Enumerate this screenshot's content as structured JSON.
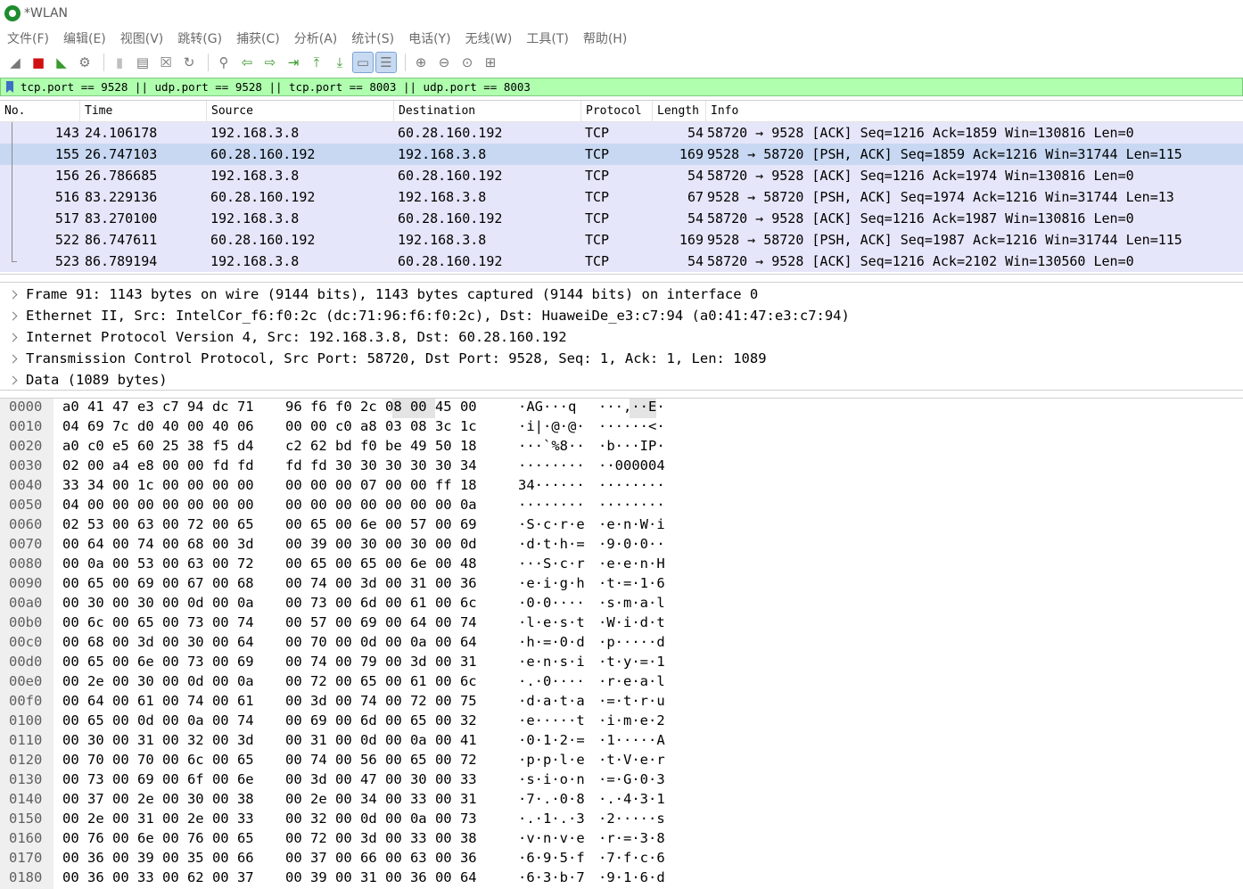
{
  "window": {
    "title": "*WLAN"
  },
  "menu": [
    "文件(F)",
    "编辑(E)",
    "视图(V)",
    "跳转(G)",
    "捕获(C)",
    "分析(A)",
    "统计(S)",
    "电话(Y)",
    "无线(W)",
    "工具(T)",
    "帮助(H)"
  ],
  "filter": {
    "value": "tcp.port == 9528 || udp.port == 9528 || tcp.port == 8003 || udp.port == 8003"
  },
  "packet_list": {
    "columns": [
      "No.",
      "Time",
      "Source",
      "Destination",
      "Protocol",
      "Length",
      "Info"
    ],
    "rows": [
      {
        "no": "143",
        "time": "24.106178",
        "src": "192.168.3.8",
        "dst": "60.28.160.192",
        "proto": "TCP",
        "len": "54",
        "info": "58720 → 9528 [ACK] Seq=1216 Ack=1859 Win=130816 Len=0"
      },
      {
        "no": "155",
        "time": "26.747103",
        "src": "60.28.160.192",
        "dst": "192.168.3.8",
        "proto": "TCP",
        "len": "169",
        "info": "9528 → 58720 [PSH, ACK] Seq=1859 Ack=1216 Win=31744 Len=115"
      },
      {
        "no": "156",
        "time": "26.786685",
        "src": "192.168.3.8",
        "dst": "60.28.160.192",
        "proto": "TCP",
        "len": "54",
        "info": "58720 → 9528 [ACK] Seq=1216 Ack=1974 Win=130816 Len=0"
      },
      {
        "no": "516",
        "time": "83.229136",
        "src": "60.28.160.192",
        "dst": "192.168.3.8",
        "proto": "TCP",
        "len": "67",
        "info": "9528 → 58720 [PSH, ACK] Seq=1974 Ack=1216 Win=31744 Len=13"
      },
      {
        "no": "517",
        "time": "83.270100",
        "src": "192.168.3.8",
        "dst": "60.28.160.192",
        "proto": "TCP",
        "len": "54",
        "info": "58720 → 9528 [ACK] Seq=1216 Ack=1987 Win=130816 Len=0"
      },
      {
        "no": "522",
        "time": "86.747611",
        "src": "60.28.160.192",
        "dst": "192.168.3.8",
        "proto": "TCP",
        "len": "169",
        "info": "9528 → 58720 [PSH, ACK] Seq=1987 Ack=1216 Win=31744 Len=115"
      },
      {
        "no": "523",
        "time": "86.789194",
        "src": "192.168.3.8",
        "dst": "60.28.160.192",
        "proto": "TCP",
        "len": "54",
        "info": "58720 → 9528 [ACK] Seq=1216 Ack=2102 Win=130560 Len=0"
      }
    ]
  },
  "details": [
    "Frame 91: 1143 bytes on wire (9144 bits), 1143 bytes captured (9144 bits) on interface 0",
    "Ethernet II, Src: IntelCor_f6:f0:2c (dc:71:96:f6:f0:2c), Dst: HuaweiDe_e3:c7:94 (a0:41:47:e3:c7:94)",
    "Internet Protocol Version 4, Src: 192.168.3.8, Dst: 60.28.160.192",
    "Transmission Control Protocol, Src Port: 58720, Dst Port: 9528, Seq: 1, Ack: 1, Len: 1089",
    "Data (1089 bytes)"
  ],
  "bytes": [
    {
      "off": "0000",
      "h1": "a0 41 47 e3 c7 94 dc 71",
      "h2": "96 f6 f0 2c 08 00 45 00",
      "a1": "·AG···q",
      "a2": "···,··E·"
    },
    {
      "off": "0010",
      "h1": "04 69 7c d0 40 00 40 06",
      "h2": "00 00 c0 a8 03 08 3c 1c",
      "a1": "·i|·@·@·",
      "a2": "······<·"
    },
    {
      "off": "0020",
      "h1": "a0 c0 e5 60 25 38 f5 d4",
      "h2": "c2 62 bd f0 be 49 50 18",
      "a1": "···`%8··",
      "a2": "·b···IP·"
    },
    {
      "off": "0030",
      "h1": "02 00 a4 e8 00 00 fd fd",
      "h2": "fd fd 30 30 30 30 30 34",
      "a1": "········",
      "a2": "··000004"
    },
    {
      "off": "0040",
      "h1": "33 34 00 1c 00 00 00 00",
      "h2": "00 00 00 07 00 00 ff 18",
      "a1": "34······",
      "a2": "········"
    },
    {
      "off": "0050",
      "h1": "04 00 00 00 00 00 00 00",
      "h2": "00 00 00 00 00 00 00 0a",
      "a1": "········",
      "a2": "········"
    },
    {
      "off": "0060",
      "h1": "02 53 00 63 00 72 00 65",
      "h2": "00 65 00 6e 00 57 00 69",
      "a1": "·S·c·r·e",
      "a2": "·e·n·W·i"
    },
    {
      "off": "0070",
      "h1": "00 64 00 74 00 68 00 3d",
      "h2": "00 39 00 30 00 30 00 0d",
      "a1": "·d·t·h·=",
      "a2": "·9·0·0··"
    },
    {
      "off": "0080",
      "h1": "00 0a 00 53 00 63 00 72",
      "h2": "00 65 00 65 00 6e 00 48",
      "a1": "···S·c·r",
      "a2": "·e·e·n·H"
    },
    {
      "off": "0090",
      "h1": "00 65 00 69 00 67 00 68",
      "h2": "00 74 00 3d 00 31 00 36",
      "a1": "·e·i·g·h",
      "a2": "·t·=·1·6"
    },
    {
      "off": "00a0",
      "h1": "00 30 00 30 00 0d 00 0a",
      "h2": "00 73 00 6d 00 61 00 6c",
      "a1": "·0·0····",
      "a2": "·s·m·a·l"
    },
    {
      "off": "00b0",
      "h1": "00 6c 00 65 00 73 00 74",
      "h2": "00 57 00 69 00 64 00 74",
      "a1": "·l·e·s·t",
      "a2": "·W·i·d·t"
    },
    {
      "off": "00c0",
      "h1": "00 68 00 3d 00 30 00 64",
      "h2": "00 70 00 0d 00 0a 00 64",
      "a1": "·h·=·0·d",
      "a2": "·p·····d"
    },
    {
      "off": "00d0",
      "h1": "00 65 00 6e 00 73 00 69",
      "h2": "00 74 00 79 00 3d 00 31",
      "a1": "·e·n·s·i",
      "a2": "·t·y·=·1"
    },
    {
      "off": "00e0",
      "h1": "00 2e 00 30 00 0d 00 0a",
      "h2": "00 72 00 65 00 61 00 6c",
      "a1": "·.·0····",
      "a2": "·r·e·a·l"
    },
    {
      "off": "00f0",
      "h1": "00 64 00 61 00 74 00 61",
      "h2": "00 3d 00 74 00 72 00 75",
      "a1": "·d·a·t·a",
      "a2": "·=·t·r·u"
    },
    {
      "off": "0100",
      "h1": "00 65 00 0d 00 0a 00 74",
      "h2": "00 69 00 6d 00 65 00 32",
      "a1": "·e·····t",
      "a2": "·i·m·e·2"
    },
    {
      "off": "0110",
      "h1": "00 30 00 31 00 32 00 3d",
      "h2": "00 31 00 0d 00 0a 00 41",
      "a1": "·0·1·2·=",
      "a2": "·1·····A"
    },
    {
      "off": "0120",
      "h1": "00 70 00 70 00 6c 00 65",
      "h2": "00 74 00 56 00 65 00 72",
      "a1": "·p·p·l·e",
      "a2": "·t·V·e·r"
    },
    {
      "off": "0130",
      "h1": "00 73 00 69 00 6f 00 6e",
      "h2": "00 3d 00 47 00 30 00 33",
      "a1": "·s·i·o·n",
      "a2": "·=·G·0·3"
    },
    {
      "off": "0140",
      "h1": "00 37 00 2e 00 30 00 38",
      "h2": "00 2e 00 34 00 33 00 31",
      "a1": "·7·.·0·8",
      "a2": "·.·4·3·1"
    },
    {
      "off": "0150",
      "h1": "00 2e 00 31 00 2e 00 33",
      "h2": "00 32 00 0d 00 0a 00 73",
      "a1": "·.·1·.·3",
      "a2": "·2·····s"
    },
    {
      "off": "0160",
      "h1": "00 76 00 6e 00 76 00 65",
      "h2": "00 72 00 3d 00 33 00 38",
      "a1": "·v·n·v·e",
      "a2": "·r·=·3·8"
    },
    {
      "off": "0170",
      "h1": "00 36 00 39 00 35 00 66",
      "h2": "00 37 00 66 00 63 00 36",
      "a1": "·6·9·5·f",
      "a2": "·7·f·c·6"
    },
    {
      "off": "0180",
      "h1": "00 36 00 33 00 62 00 37",
      "h2": "00 39 00 31 00 36 00 64",
      "a1": "·6·3·b·7",
      "a2": "·9·1·6·d"
    }
  ]
}
